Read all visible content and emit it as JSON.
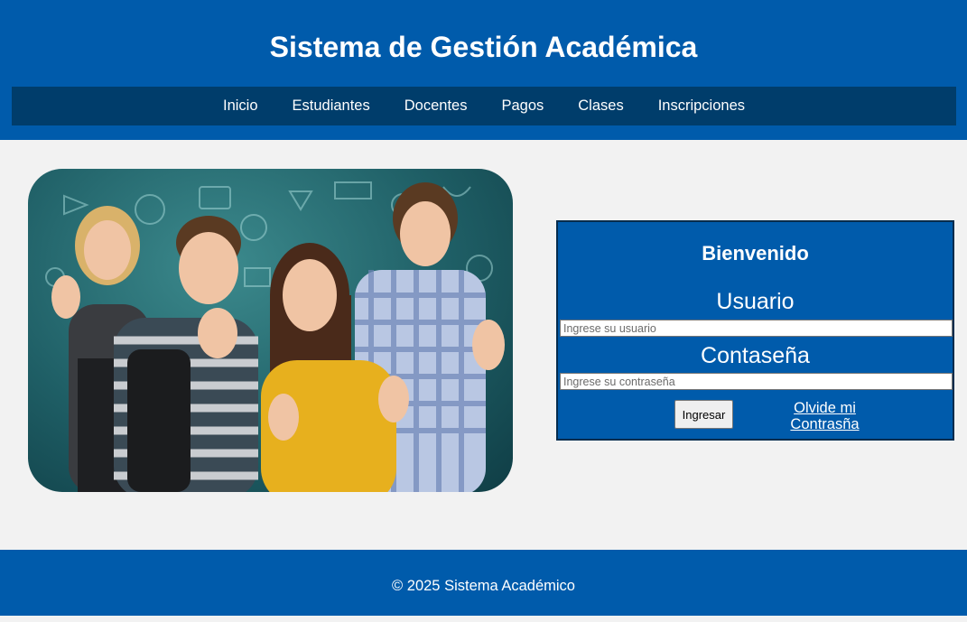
{
  "header": {
    "title": "Sistema de Gestión Académica",
    "nav": [
      "Inicio",
      "Estudiantes",
      "Docentes",
      "Pagos",
      "Clases",
      "Inscripciones"
    ]
  },
  "login": {
    "title": "Bienvenido",
    "user_label": "Usuario",
    "user_placeholder": "Ingrese su usuario",
    "password_label": "Contaseña",
    "password_placeholder": "Ingrese su contraseña",
    "submit_label": "Ingresar",
    "forgot_line1": "Olvide mi",
    "forgot_line2": "Contrasña"
  },
  "footer": {
    "text": "© 2025 Sistema Académico"
  },
  "colors": {
    "primary": "#005bab",
    "nav_bg": "#003d6b",
    "page_bg": "#f2f2f2"
  }
}
